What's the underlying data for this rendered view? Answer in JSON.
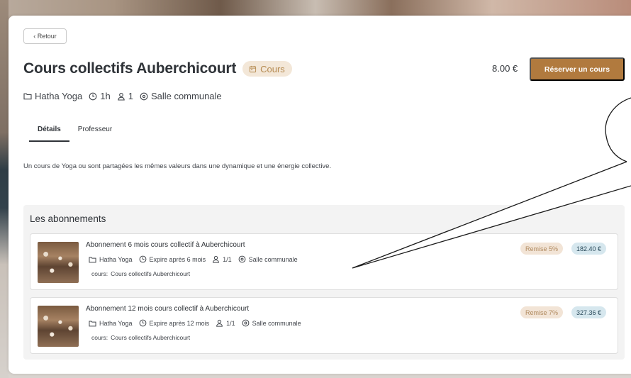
{
  "back_button": {
    "label": "‹ Retour"
  },
  "course": {
    "title": "Cours collectifs Auberchicourt",
    "category_badge": "Cours",
    "price": "8.00 €",
    "book_button": "Réserver un cours",
    "meta": {
      "style": "Hatha Yoga",
      "duration": "1h",
      "capacity": "1",
      "location": "Salle communale"
    }
  },
  "tabs": [
    {
      "label": "Détails",
      "active": true
    },
    {
      "label": "Professeur",
      "active": false
    }
  ],
  "description": "Un cours de Yoga ou sont partagées les mêmes valeurs dans une dynamique et une énergie collective.",
  "subscriptions": {
    "title": "Les abonnements",
    "items": [
      {
        "name": "Abonnement 6 mois cours collectif à Auberchicourt",
        "style": "Hatha Yoga",
        "expiry": "Expire après 6 mois",
        "capacity": "1/1",
        "location": "Salle communale",
        "cours_label": "cours:",
        "cours_value": "Cours collectifs Auberchicourt",
        "discount": "Remise 5%",
        "price": "182.40 €"
      },
      {
        "name": "Abonnement 12 mois cours collectif à Auberchicourt",
        "style": "Hatha Yoga",
        "expiry": "Expire après 12 mois",
        "capacity": "1/1",
        "location": "Salle communale",
        "cours_label": "cours:",
        "cours_value": "Cours collectifs Auberchicourt",
        "discount": "Remise 7%",
        "price": "327.36 €"
      }
    ]
  },
  "colors": {
    "accent": "#b17a3e",
    "badge_bg": "#f3e7d8",
    "price_badge_bg": "#d6e7ee",
    "text": "#2f3338"
  },
  "icons": {
    "category": "calendar-icon",
    "style": "folder-icon",
    "duration": "clock-icon",
    "capacity": "user-icon",
    "location": "location-pin-icon"
  }
}
